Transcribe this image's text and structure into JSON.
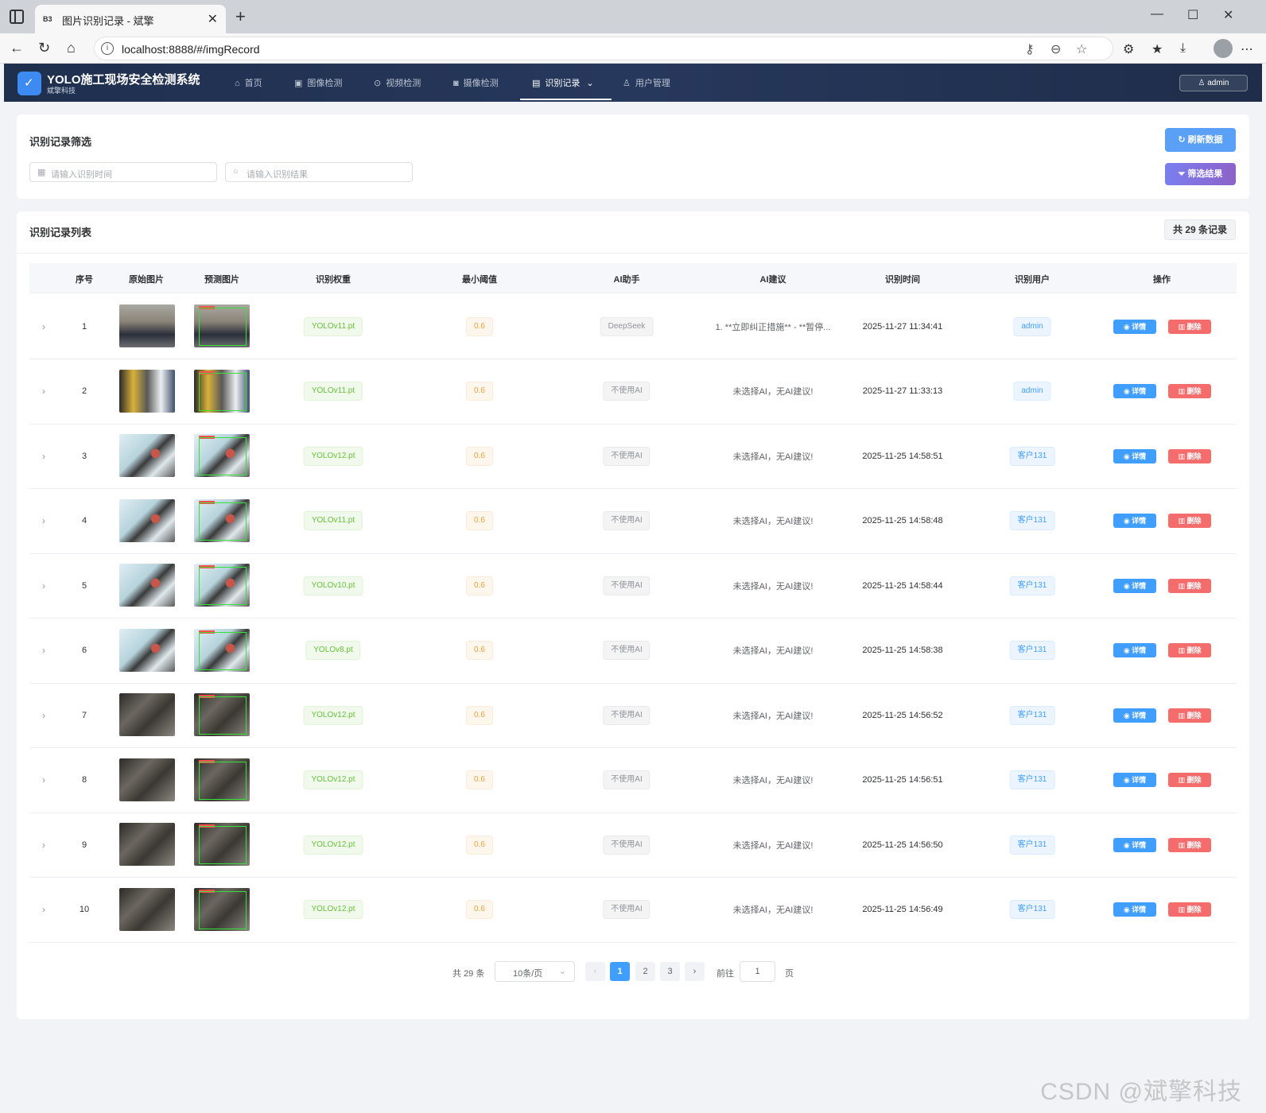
{
  "browser": {
    "tab_title": "图片识别记录 - 斌擎",
    "favicon_text": "B3",
    "url": "localhost:8888/#/imgRecord"
  },
  "app": {
    "title": "YOLO施工现场安全检测系统",
    "subtitle": "斌擎科技",
    "user": "admin",
    "nav": [
      {
        "label": "首页",
        "icon": "home-icon"
      },
      {
        "label": "图像检测",
        "icon": "image-icon"
      },
      {
        "label": "视频检测",
        "icon": "play-icon"
      },
      {
        "label": "摄像检测",
        "icon": "camera-icon"
      },
      {
        "label": "识别记录",
        "icon": "document-icon",
        "active": true
      },
      {
        "label": "用户管理",
        "icon": "user-icon"
      }
    ]
  },
  "filter": {
    "title": "识别记录筛选",
    "time_placeholder": "请输入识别时间",
    "result_placeholder": "请输入识别结果",
    "refresh_label": "刷新数据",
    "filter_label": "筛选结果"
  },
  "list": {
    "title": "识别记录列表",
    "count_label": "共 29 条记录",
    "columns": [
      "序号",
      "原始图片",
      "预测图片",
      "识别权重",
      "最小阈值",
      "AI助手",
      "AI建议",
      "识别时间",
      "识别用户",
      "操作"
    ],
    "detail_label": "详情",
    "delete_label": "删除",
    "rows": [
      {
        "idx": "1",
        "weight": "YOLOv11.pt",
        "threshold": "0.6",
        "ai": "DeepSeek",
        "advice": "1. **立即纠正措施** - **暂停...",
        "time": "2025-11-27 11:34:41",
        "user": "admin",
        "scene": "group"
      },
      {
        "idx": "2",
        "weight": "YOLOv11.pt",
        "threshold": "0.6",
        "ai": "不使用AI",
        "advice": "未选择AI，无AI建议!",
        "time": "2025-11-27 11:33:13",
        "user": "admin",
        "scene": "meeting"
      },
      {
        "idx": "3",
        "weight": "YOLOv12.pt",
        "threshold": "0.6",
        "ai": "不使用AI",
        "advice": "未选择AI，无AI建议!",
        "time": "2025-11-25 14:58:51",
        "user": "客户131",
        "scene": "climber"
      },
      {
        "idx": "4",
        "weight": "YOLOv11.pt",
        "threshold": "0.6",
        "ai": "不使用AI",
        "advice": "未选择AI，无AI建议!",
        "time": "2025-11-25 14:58:48",
        "user": "客户131",
        "scene": "climber"
      },
      {
        "idx": "5",
        "weight": "YOLOv10.pt",
        "threshold": "0.6",
        "ai": "不使用AI",
        "advice": "未选择AI，无AI建议!",
        "time": "2025-11-25 14:58:44",
        "user": "客户131",
        "scene": "climber"
      },
      {
        "idx": "6",
        "weight": "YOLOv8.pt",
        "threshold": "0.6",
        "ai": "不使用AI",
        "advice": "未选择AI，无AI建议!",
        "time": "2025-11-25 14:58:38",
        "user": "客户131",
        "scene": "climber"
      },
      {
        "idx": "7",
        "weight": "YOLOv12.pt",
        "threshold": "0.6",
        "ai": "不使用AI",
        "advice": "未选择AI，无AI建议!",
        "time": "2025-11-25 14:56:52",
        "user": "客户131",
        "scene": "rock"
      },
      {
        "idx": "8",
        "weight": "YOLOv12.pt",
        "threshold": "0.6",
        "ai": "不使用AI",
        "advice": "未选择AI，无AI建议!",
        "time": "2025-11-25 14:56:51",
        "user": "客户131",
        "scene": "rock"
      },
      {
        "idx": "9",
        "weight": "YOLOv12.pt",
        "threshold": "0.6",
        "ai": "不使用AI",
        "advice": "未选择AI，无AI建议!",
        "time": "2025-11-25 14:56:50",
        "user": "客户131",
        "scene": "rock"
      },
      {
        "idx": "10",
        "weight": "YOLOv12.pt",
        "threshold": "0.6",
        "ai": "不使用AI",
        "advice": "未选择AI，无AI建议!",
        "time": "2025-11-25 14:56:49",
        "user": "客户131",
        "scene": "rock"
      }
    ]
  },
  "pagination": {
    "total": "共 29 条",
    "page_size": "10条/页",
    "pages": [
      "1",
      "2",
      "3"
    ],
    "current": "1",
    "goto_label": "前往",
    "goto_value": "1",
    "page_suffix": "页"
  },
  "watermark": "CSDN @斌擎科技"
}
